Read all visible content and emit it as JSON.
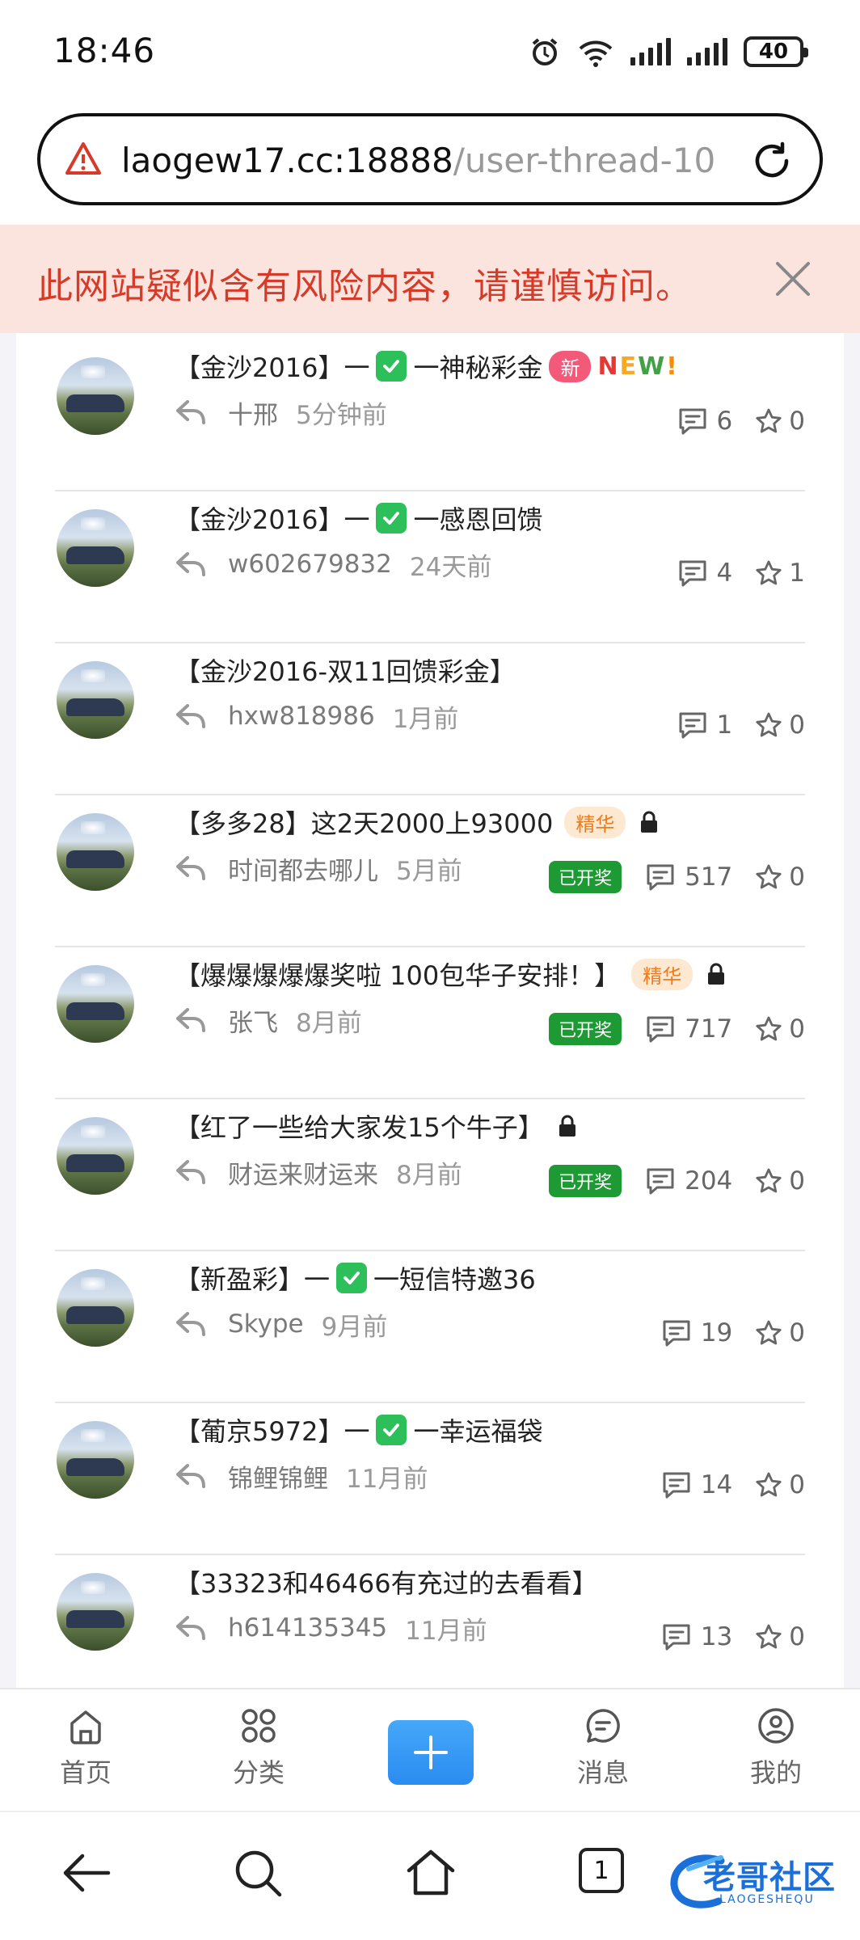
{
  "status_bar": {
    "time": "18:46",
    "battery": "40"
  },
  "url_bar": {
    "domain": "laogew17.cc:18888",
    "path": "/user-thread-10"
  },
  "risk_banner": {
    "message": "此网站疑似含有风险内容，请谨慎访问。"
  },
  "threads": [
    {
      "title_parts": [
        "【金沙2016】一",
        "一神秘彩金"
      ],
      "has_check": true,
      "badge_new": "新",
      "new_text": "NEW!",
      "badge_jinghua": "",
      "locked": false,
      "author": "十邢",
      "time": "5分钟前",
      "tag_kaijiang": "",
      "comments": "6",
      "stars": "0"
    },
    {
      "title_parts": [
        "【金沙2016】一",
        "一感恩回馈"
      ],
      "has_check": true,
      "badge_new": "",
      "new_text": "",
      "badge_jinghua": "",
      "locked": false,
      "author": "w602679832",
      "time": "24天前",
      "tag_kaijiang": "",
      "comments": "4",
      "stars": "1"
    },
    {
      "title_parts": [
        "【金沙2016-双11回馈彩金】"
      ],
      "has_check": false,
      "badge_new": "",
      "new_text": "",
      "badge_jinghua": "",
      "locked": false,
      "author": "hxw818986",
      "time": "1月前",
      "tag_kaijiang": "",
      "comments": "1",
      "stars": "0"
    },
    {
      "title_parts": [
        "【多多28】这2天2000上93000"
      ],
      "has_check": false,
      "badge_new": "",
      "new_text": "",
      "badge_jinghua": "精华",
      "locked": true,
      "author": "时间都去哪儿",
      "time": "5月前",
      "tag_kaijiang": "已开奖",
      "comments": "517",
      "stars": "0"
    },
    {
      "title_parts": [
        "【爆爆爆爆爆奖啦 100包华子安排！】"
      ],
      "has_check": false,
      "badge_new": "",
      "new_text": "",
      "badge_jinghua": "精华",
      "locked": true,
      "author": "张飞",
      "time": "8月前",
      "tag_kaijiang": "已开奖",
      "comments": "717",
      "stars": "0"
    },
    {
      "title_parts": [
        "【红了一些给大家发15个牛子】"
      ],
      "has_check": false,
      "badge_new": "",
      "new_text": "",
      "badge_jinghua": "",
      "locked": true,
      "author": "财运来财运来",
      "time": "8月前",
      "tag_kaijiang": "已开奖",
      "comments": "204",
      "stars": "0"
    },
    {
      "title_parts": [
        "【新盈彩】一",
        "一短信特邀36"
      ],
      "has_check": true,
      "badge_new": "",
      "new_text": "",
      "badge_jinghua": "",
      "locked": false,
      "author": "Skype",
      "time": "9月前",
      "tag_kaijiang": "",
      "comments": "19",
      "stars": "0"
    },
    {
      "title_parts": [
        "【葡京5972】一",
        "一幸运福袋"
      ],
      "has_check": true,
      "badge_new": "",
      "new_text": "",
      "badge_jinghua": "",
      "locked": false,
      "author": "锦鲤锦鲤",
      "time": "11月前",
      "tag_kaijiang": "",
      "comments": "14",
      "stars": "0"
    },
    {
      "title_parts": [
        "【33323和46466有充过的去看看】"
      ],
      "has_check": false,
      "badge_new": "",
      "new_text": "",
      "badge_jinghua": "",
      "locked": false,
      "author": "h614135345",
      "time": "11月前",
      "tag_kaijiang": "",
      "comments": "13",
      "stars": "0"
    }
  ],
  "tabbar": {
    "home": "首页",
    "category": "分类",
    "messages": "消息",
    "mine": "我的"
  },
  "browser_nav": {
    "tab_count": "1"
  },
  "watermark": {
    "title": "老哥社区",
    "subtitle": "LAOGESHEQU"
  },
  "colors": {
    "accent": "#2a8cf0",
    "risk": "#d63b2a",
    "kaijiang": "#1e9a34",
    "jinghua": "#ef7b1b",
    "badge_new": "#f35a7a"
  }
}
